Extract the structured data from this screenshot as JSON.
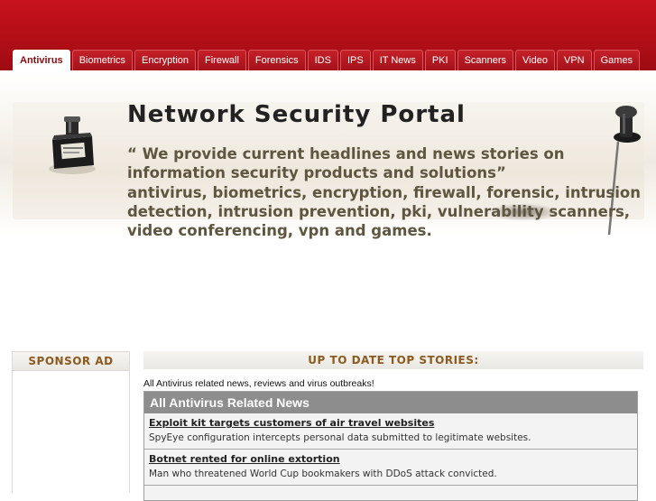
{
  "nav": {
    "tabs": [
      {
        "label": "Antivirus",
        "active": true
      },
      {
        "label": "Biometrics"
      },
      {
        "label": "Encryption"
      },
      {
        "label": "Firewall"
      },
      {
        "label": "Forensics"
      },
      {
        "label": "IDS"
      },
      {
        "label": "IPS"
      },
      {
        "label": "IT News"
      },
      {
        "label": "PKI"
      },
      {
        "label": "Scanners"
      },
      {
        "label": "Video"
      },
      {
        "label": "VPN"
      },
      {
        "label": "Games"
      }
    ]
  },
  "banner": {
    "title": "Network Security Portal",
    "tagline": "“ We provide current headlines and news stories on information security products and solutions”",
    "keywords": "antivirus, biometrics, encryption, firewall, forensic, intrusion detection, intrusion prevention, pki, vulnerability scanners, video conferencing, vpn and games."
  },
  "sponsor": {
    "heading": "SPONSOR AD"
  },
  "stories": {
    "heading": "UP TO DATE TOP STORIES:",
    "intro": "All Antivirus related news, reviews and virus outbreaks!",
    "box_title": "All Antivirus Related News",
    "items": [
      {
        "title": "Exploit kit targets customers of air travel websites",
        "desc": "SpyEye configuration intercepts personal data submitted to legitimate websites."
      },
      {
        "title": "Botnet rented for online extortion",
        "desc": "Man who threatened World Cup bookmakers with DDoS attack convicted."
      }
    ]
  }
}
